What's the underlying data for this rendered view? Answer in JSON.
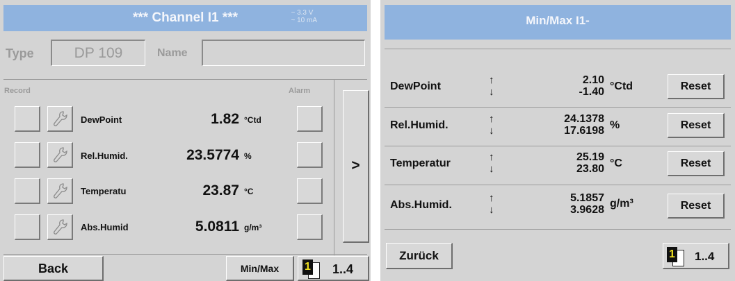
{
  "channel_screen": {
    "title": "***  Channel I1  ***",
    "range_line1": "~ 3.3 V",
    "range_line2": "~ 10 mA",
    "type_label": "Type",
    "type_value": "DP 109",
    "name_label": "Name",
    "name_value": "",
    "record_label": "Record",
    "alarm_label": "Alarm",
    "measurements": [
      {
        "name": "DewPoint",
        "value": "1.82",
        "unit": "°Ctd"
      },
      {
        "name": "Rel.Humid.",
        "value": "23.5774",
        "unit": "%"
      },
      {
        "name": "Temperatu",
        "value": "23.87",
        "unit": "°C"
      },
      {
        "name": "Abs.Humid",
        "value": "5.0811",
        "unit": "g/m³"
      }
    ],
    "next_label": ">",
    "back_label": "Back",
    "minmax_label": "Min/Max",
    "page_badge": "1",
    "page_range": "1..4"
  },
  "minmax_screen": {
    "title": "Min/Max I1-",
    "rows": [
      {
        "name": "DewPoint",
        "up": "↑",
        "down": "↓",
        "max": "2.10",
        "min": "-1.40",
        "unit": "°Ctd",
        "reset": "Reset"
      },
      {
        "name": "Rel.Humid.",
        "up": "↑",
        "down": "↓",
        "max": "24.1378",
        "min": "17.6198",
        "unit": "%",
        "reset": "Reset"
      },
      {
        "name": "Temperatur",
        "up": "↑",
        "down": "↓",
        "max": "25.19",
        "min": "23.80",
        "unit": "°C",
        "reset": "Reset"
      },
      {
        "name": "Abs.Humid.",
        "up": "↑",
        "down": "↓",
        "max": "5.1857",
        "min": "3.9628",
        "unit": "g/m³",
        "reset": "Reset"
      }
    ],
    "back_label": "Zurück",
    "page_badge": "1",
    "page_range": "1..4"
  },
  "colors": {
    "header": "#8fb3df",
    "panel": "#d4d4d4",
    "badge": "#f0e020"
  }
}
